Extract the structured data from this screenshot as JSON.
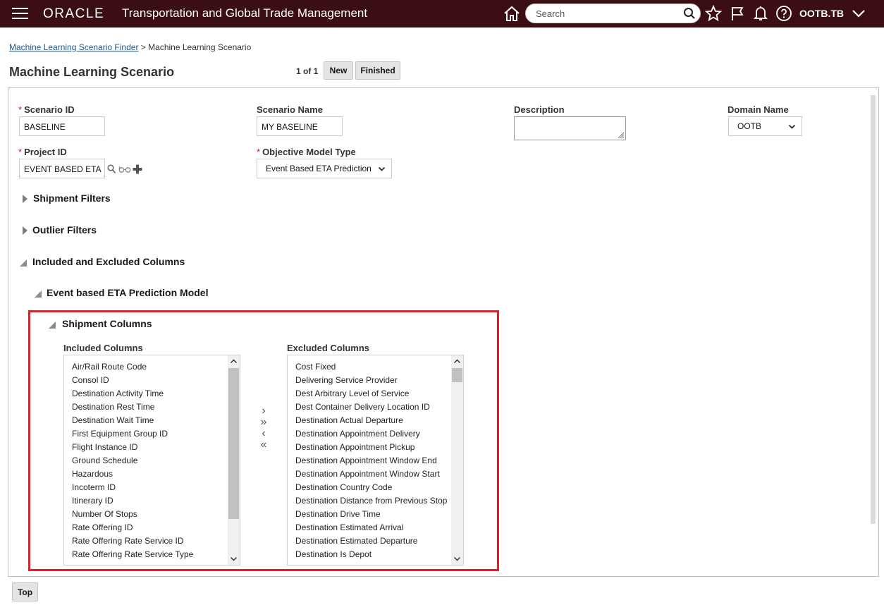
{
  "header": {
    "logo": "ORACLE",
    "title": "Transportation and Global Trade Management",
    "search_placeholder": "Search",
    "user": "OOTB.TB"
  },
  "breadcrumb": {
    "finder_link": "Machine Learning Scenario Finder",
    "separator": ">",
    "current": "Machine Learning Scenario"
  },
  "page": {
    "title": "Machine Learning Scenario",
    "pager": "1 of 1",
    "new_label": "New",
    "finished_label": "Finished",
    "top_label": "Top"
  },
  "form": {
    "scenario_id_label": "Scenario ID",
    "scenario_id_value": "BASELINE",
    "scenario_name_label": "Scenario Name",
    "scenario_name_value": "MY BASELINE",
    "description_label": "Description",
    "domain_name_label": "Domain Name",
    "domain_name_value": "OOTB",
    "project_id_label": "Project ID",
    "project_id_value": "EVENT BASED ETA",
    "objective_model_type_label": "Objective Model Type",
    "objective_model_type_value": "Event Based ETA Prediction",
    "required_mark": "*"
  },
  "sections": {
    "shipment_filters": "Shipment Filters",
    "outlier_filters": "Outlier Filters",
    "included_excluded": "Included and Excluded Columns",
    "event_model": "Event based ETA Prediction Model",
    "shipment_columns": "Shipment Columns"
  },
  "shuttle": {
    "included_label": "Included Columns",
    "excluded_label": "Excluded Columns",
    "move_one": "›",
    "move_all": "»",
    "remove_one": "‹",
    "remove_all": "«",
    "included": [
      "Air/Rail Route Code",
      "Consol ID",
      "Destination Activity Time",
      "Destination Rest Time",
      "Destination Wait Time",
      "First Equipment Group ID",
      "Flight Instance ID",
      "Ground Schedule",
      "Hazardous",
      "Incoterm ID",
      "Itinerary ID",
      "Number Of Stops",
      "Rate Offering ID",
      "Rate Offering Rate Service ID",
      "Rate Offering Rate Service Type"
    ],
    "excluded": [
      "Cost Fixed",
      "Delivering Service Provider",
      "Dest Arbitrary Level of Service",
      "Dest Container Delivery Location ID",
      "Destination Actual Departure",
      "Destination Appointment Delivery",
      "Destination Appointment Pickup",
      "Destination Appointment Window End",
      "Destination Appointment Window Start",
      "Destination Country Code",
      "Destination Distance from Previous Stop",
      "Destination Drive Time",
      "Destination Estimated Arrival",
      "Destination Estimated Departure",
      "Destination Is Depot"
    ]
  },
  "icons": {
    "menu": "hamburger-icon",
    "home": "home-icon",
    "search": "search-icon",
    "favorite": "star-icon",
    "flag": "flag-icon",
    "notifications": "bell-icon",
    "help": "help-icon",
    "user_menu": "chevron-down-icon"
  }
}
